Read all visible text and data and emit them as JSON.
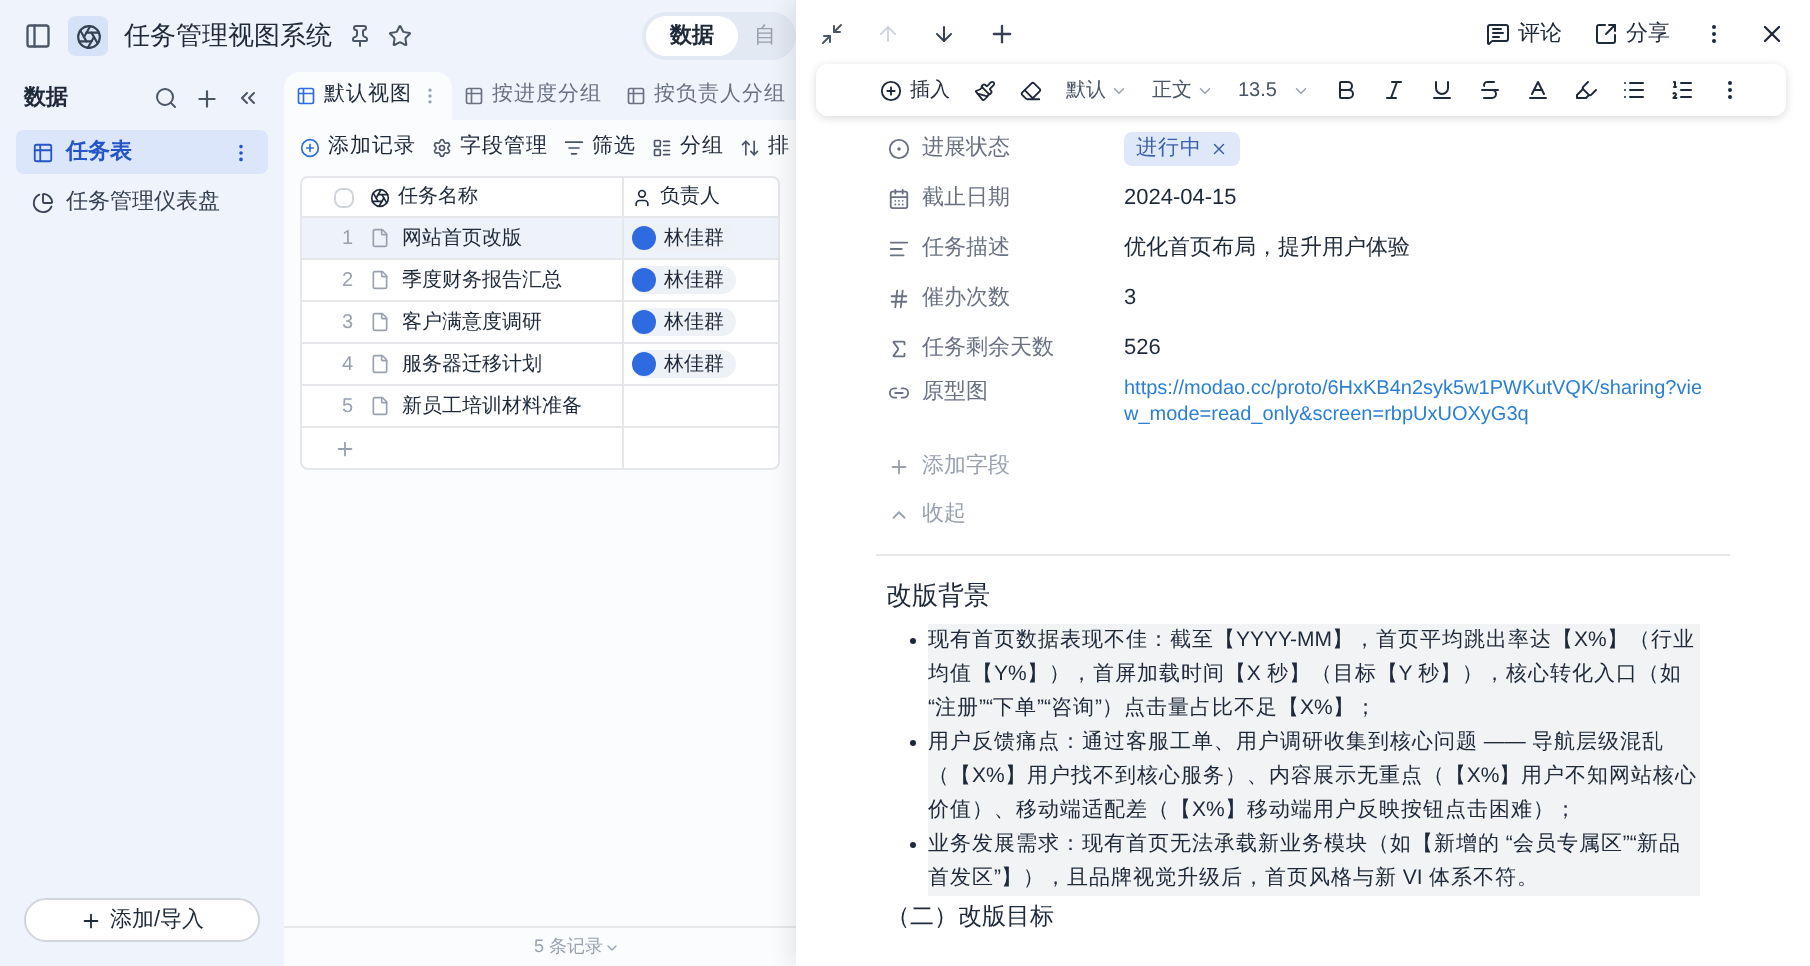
{
  "app": {
    "title": "任务管理视图系统",
    "mode_tabs": [
      {
        "label": "数据",
        "selected": true
      },
      {
        "label": "自",
        "selected": false
      }
    ]
  },
  "sidebar": {
    "title": "数据",
    "items": [
      {
        "label": "任务表",
        "kind": "table",
        "selected": true
      },
      {
        "label": "任务管理仪表盘",
        "kind": "dashboard",
        "selected": false
      }
    ],
    "add_button": "添加/导入"
  },
  "views": [
    {
      "label": "默认视图",
      "selected": true
    },
    {
      "label": "按进度分组",
      "selected": false
    },
    {
      "label": "按负责人分组",
      "selected": false
    }
  ],
  "toolbar": [
    {
      "kind": "add",
      "label": "添加记录"
    },
    {
      "kind": "fields",
      "label": "字段管理"
    },
    {
      "kind": "filter",
      "label": "筛选"
    },
    {
      "kind": "group",
      "label": "分组"
    },
    {
      "kind": "sort",
      "label": "排"
    }
  ],
  "table": {
    "select_all_checked": false,
    "columns": [
      "任务名称",
      "负责人"
    ],
    "rows": [
      {
        "index": "1",
        "name": "网站首页改版",
        "assignee": "林佳群",
        "selected": true
      },
      {
        "index": "2",
        "name": "季度财务报告汇总",
        "assignee": "林佳群",
        "selected": false
      },
      {
        "index": "3",
        "name": "客户满意度调研",
        "assignee": "林佳群",
        "selected": false
      },
      {
        "index": "4",
        "name": "服务器迁移计划",
        "assignee": "林佳群",
        "selected": false
      },
      {
        "index": "5",
        "name": "新员工培训材料准备",
        "selected": false
      }
    ],
    "footer": "5 条记录"
  },
  "record": {
    "header_actions": [
      "评论",
      "分享"
    ],
    "format_toolbar": {
      "insert": "插入",
      "font": "默认",
      "style": "正文",
      "size": "13.5"
    },
    "fields": [
      {
        "kind": "status",
        "label": "进展状态",
        "value": "进行中"
      },
      {
        "kind": "date",
        "label": "截止日期",
        "value": "2024-04-15"
      },
      {
        "kind": "text",
        "label": "任务描述",
        "value": "优化首页布局，提升用户体验"
      },
      {
        "kind": "number",
        "label": "催办次数",
        "value": "3"
      },
      {
        "kind": "formula",
        "label": "任务剩余天数",
        "value": "526"
      },
      {
        "kind": "link",
        "label": "原型图",
        "value": "https://modao.cc/proto/6HxKB4n2syk5w1PWKutVQK/sharing?view_mode=read_only&screen=rbpUxUOXyG3q"
      }
    ],
    "add_field": "添加字段",
    "collapse": "收起",
    "document": {
      "heading": "改版背景",
      "bullets": [
        "现有首页数据表现不佳：截至【YYYY-MM】，首页平均跳出率达【X%】（行业均值【Y%】），首屏加载时间【X 秒】（目标【Y 秒】），核心转化入口（如 “注册”“下单”“咨询”）点击量占比不足【X%】；",
        "用户反馈痛点：通过客服工单、用户调研收集到核心问题 —— 导航层级混乱（【X%】用户找不到核心服务）、内容展示无重点（【X%】用户不知网站核心价值）、移动端适配差（【X%】移动端用户反映按钮点击困难）；",
        "业务发展需求：现有首页无法承载新业务模块（如【新增的 “会员专属区”“新品首发区”】），且品牌视觉升级后，首页风格与新 VI 体系不符。"
      ],
      "next_heading": "（二）改版目标"
    }
  }
}
